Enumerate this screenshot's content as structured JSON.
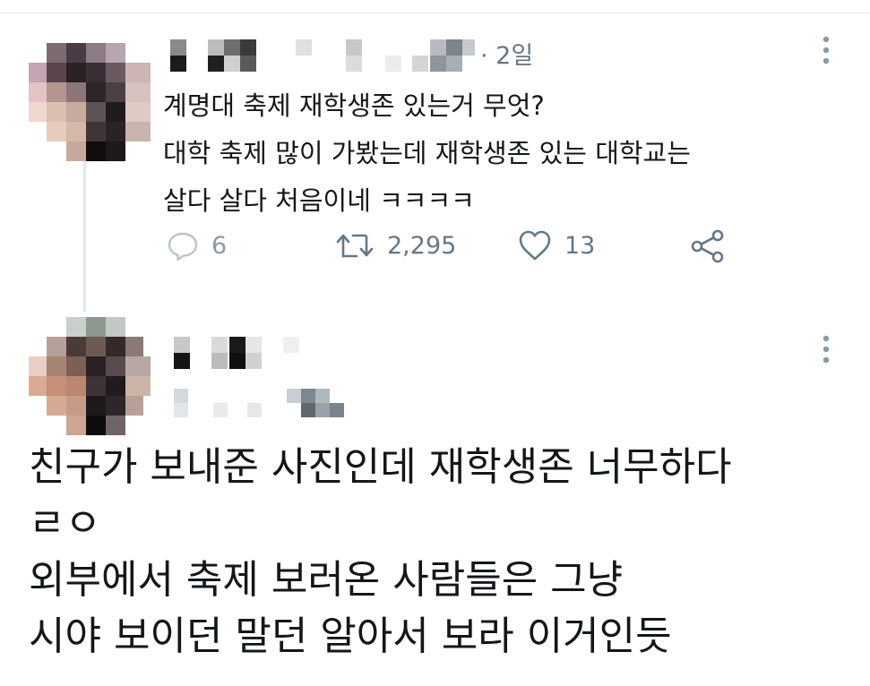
{
  "tweet1": {
    "time": "· 2일",
    "text_lines": [
      "계명대 축제 재학생존 있는거 무엇?",
      "대학 축제 많이 가봤는데 재학생존 있는 대학교는",
      "살다 살다 처음이네 ㅋㅋㅋㅋ"
    ],
    "reply_count": "6",
    "retweet_count": "2,295",
    "like_count": "13",
    "icons": {
      "reply": "reply-icon",
      "retweet": "retweet-icon",
      "like": "heart-icon",
      "share": "share-icon",
      "more": "more-vertical-icon"
    }
  },
  "tweet2": {
    "text_lines": [
      "친구가 보내준 사진인데 재학생존 너무하다",
      "ㄹㅇ",
      "외부에서 축제 보러온 사람들은 그냥",
      "시야 보이던 말던 알아서 보라 이거인듯"
    ],
    "icons": {
      "more": "more-vertical-icon"
    }
  },
  "colors": {
    "text": "#14171a",
    "secondary": "#657786",
    "divider": "#e6ecf0",
    "thread_line": "#e1e8ed"
  }
}
